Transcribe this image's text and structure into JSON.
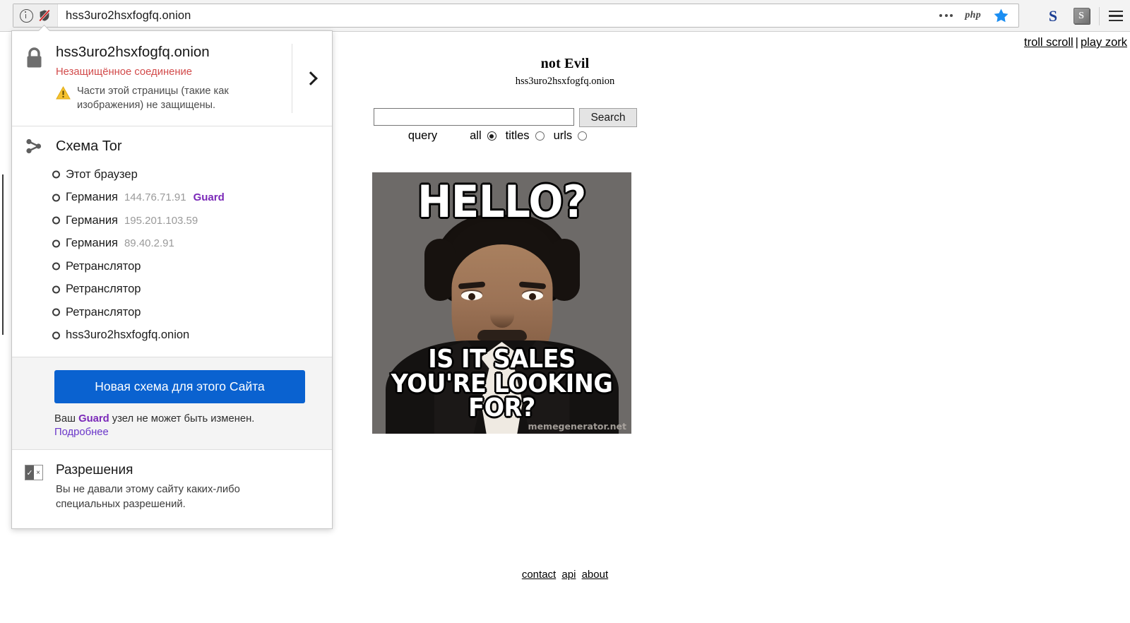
{
  "browser": {
    "url": "hss3uro2hsxfogfq.onion",
    "info_icon": "info-circle-icon",
    "shield_icon": "shield-broken-icon",
    "more_icon": "more-dots-icon",
    "php_label": "php",
    "bookmark_icon": "star-icon",
    "ext1_label": "S",
    "ext2_label": "S",
    "menu_icon": "hamburger-menu-icon"
  },
  "identity_panel": {
    "site": {
      "host": "hss3uro2hsxfogfq.onion",
      "connection_status": "Незащищённое соединение",
      "status_color": "#d24b4b",
      "mixed_content_warning": "Части этой страницы (такие как изображения) не защищены.",
      "lock_icon": "lock-icon",
      "warning_icon": "warning-triangle-icon",
      "expand_icon": "chevron-right-icon"
    },
    "tor": {
      "title": "Схема Tor",
      "icon": "tor-circuit-icon",
      "nodes": [
        {
          "label": "Этот браузер",
          "ip": "",
          "tag": ""
        },
        {
          "label": "Германия",
          "ip": "144.76.71.91",
          "tag": "Guard"
        },
        {
          "label": "Германия",
          "ip": "195.201.103.59",
          "tag": ""
        },
        {
          "label": "Германия",
          "ip": "89.40.2.91",
          "tag": ""
        },
        {
          "label": "Ретранслятор",
          "ip": "",
          "tag": ""
        },
        {
          "label": "Ретранслятор",
          "ip": "",
          "tag": ""
        },
        {
          "label": "Ретранслятор",
          "ip": "",
          "tag": ""
        },
        {
          "label": "hss3uro2hsxfogfq.onion",
          "ip": "",
          "tag": ""
        }
      ],
      "guard_color": "#7a28b8"
    },
    "new_circuit": {
      "button_label": "Новая схема для этого Сайта",
      "button_color": "#0a62d0",
      "note_prefix": "Ваш ",
      "note_bold": "Guard",
      "note_suffix": " узел не может быть изменен.",
      "learn_more": "Подробнее"
    },
    "permissions": {
      "title": "Разрешения",
      "description": "Вы не давали этому сайту каких-либо специальных разрешений.",
      "icon": "permissions-icon",
      "icon_yes": "✓",
      "icon_no": "×"
    }
  },
  "page": {
    "top_links": [
      {
        "label": "troll scroll"
      },
      {
        "label": "play zork"
      }
    ],
    "top_links_separator": "|",
    "site_name": "not Evil",
    "site_onion": "hss3uro2hsxfogfq.onion",
    "search": {
      "value": "",
      "placeholder": "",
      "button_label": "Search"
    },
    "options": {
      "query_label": "query",
      "choices": [
        {
          "label": "all",
          "selected": true
        },
        {
          "label": "titles",
          "selected": false
        },
        {
          "label": "urls",
          "selected": false
        }
      ]
    },
    "meme": {
      "top_text": "HELLO?",
      "bottom_text": "IS IT SALES YOU'RE LOOKING FOR?",
      "watermark": "memegenerator.net"
    },
    "footer_links": [
      {
        "label": "contact"
      },
      {
        "label": "api"
      },
      {
        "label": "about"
      }
    ]
  }
}
